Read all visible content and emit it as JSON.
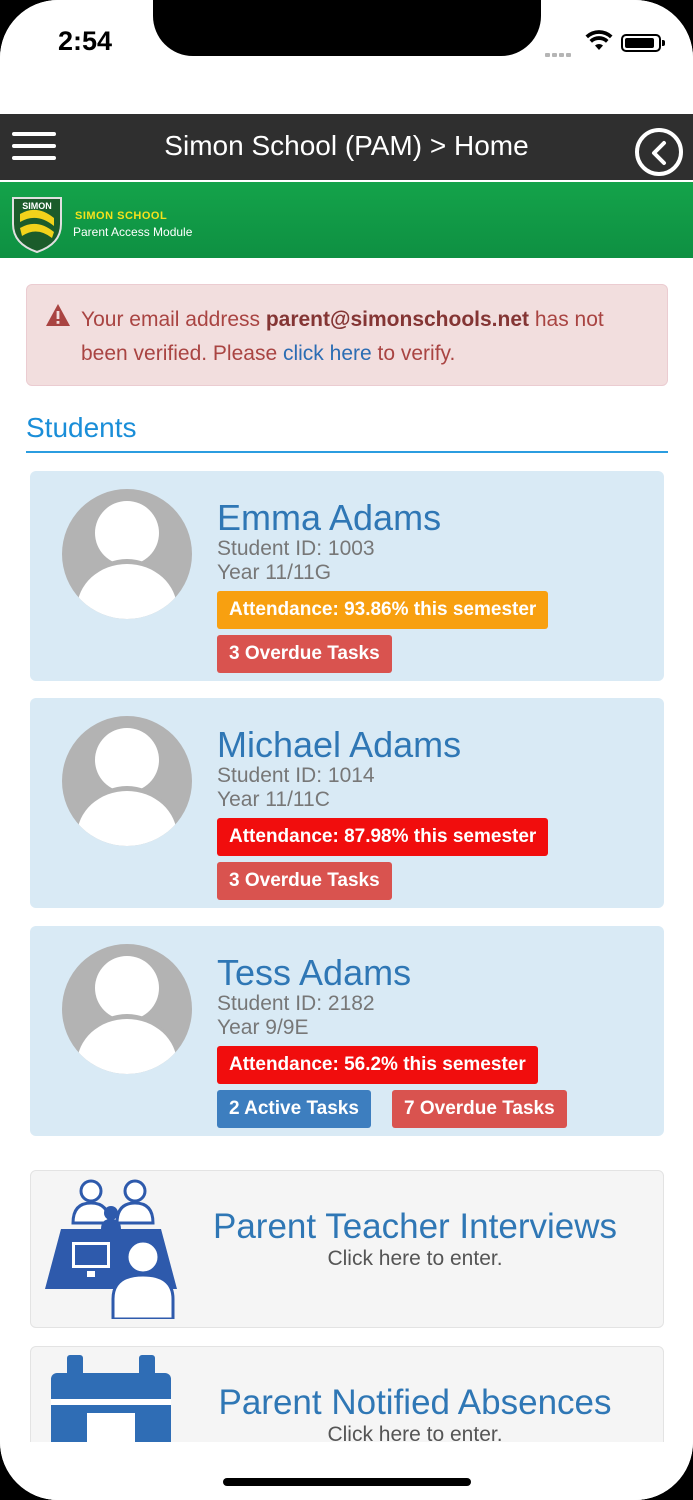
{
  "status_bar": {
    "time": "2:54"
  },
  "navbar": {
    "title": "Simon School (PAM) > Home"
  },
  "brand": {
    "logo_text": "SIMON",
    "name": "SIMON SCHOOL",
    "subtitle": "Parent Access Module"
  },
  "alert": {
    "text_before": "Your email address ",
    "email": "parent@simonschools.net",
    "text_middle": " has not been verified. Please ",
    "link_text": "click here",
    "text_after": " to verify."
  },
  "students": {
    "heading": "Students",
    "items": [
      {
        "name": "Emma Adams",
        "student_id": "Student ID: 1003",
        "year": "Year 11/11G",
        "attendance": "Attendance: 93.86% this semester",
        "overdue": "3 Overdue Tasks"
      },
      {
        "name": "Michael Adams",
        "student_id": "Student ID: 1014",
        "year": "Year 11/11C",
        "attendance": "Attendance: 87.98% this semester",
        "overdue": "3 Overdue Tasks"
      },
      {
        "name": "Tess Adams",
        "student_id": "Student ID: 2182",
        "year": "Year 9/9E",
        "attendance": "Attendance: 56.2% this semester",
        "active": "2 Active Tasks",
        "overdue": "7 Overdue Tasks"
      }
    ]
  },
  "modules": [
    {
      "title": "Parent Teacher Interviews",
      "subtitle": "Click here to enter.",
      "icon": "interview-icon"
    },
    {
      "title": "Parent Notified Absences",
      "subtitle": "Click here to enter.",
      "icon": "calendar-icon"
    }
  ],
  "colors": {
    "navbar": "#2f2f2f",
    "brand_green": "#14a34a",
    "link_blue": "#2f77b5",
    "badge_orange": "#f8a010",
    "badge_red": "#f10d0d",
    "badge_danger": "#d9534f",
    "badge_blue": "#3d7ebf"
  }
}
